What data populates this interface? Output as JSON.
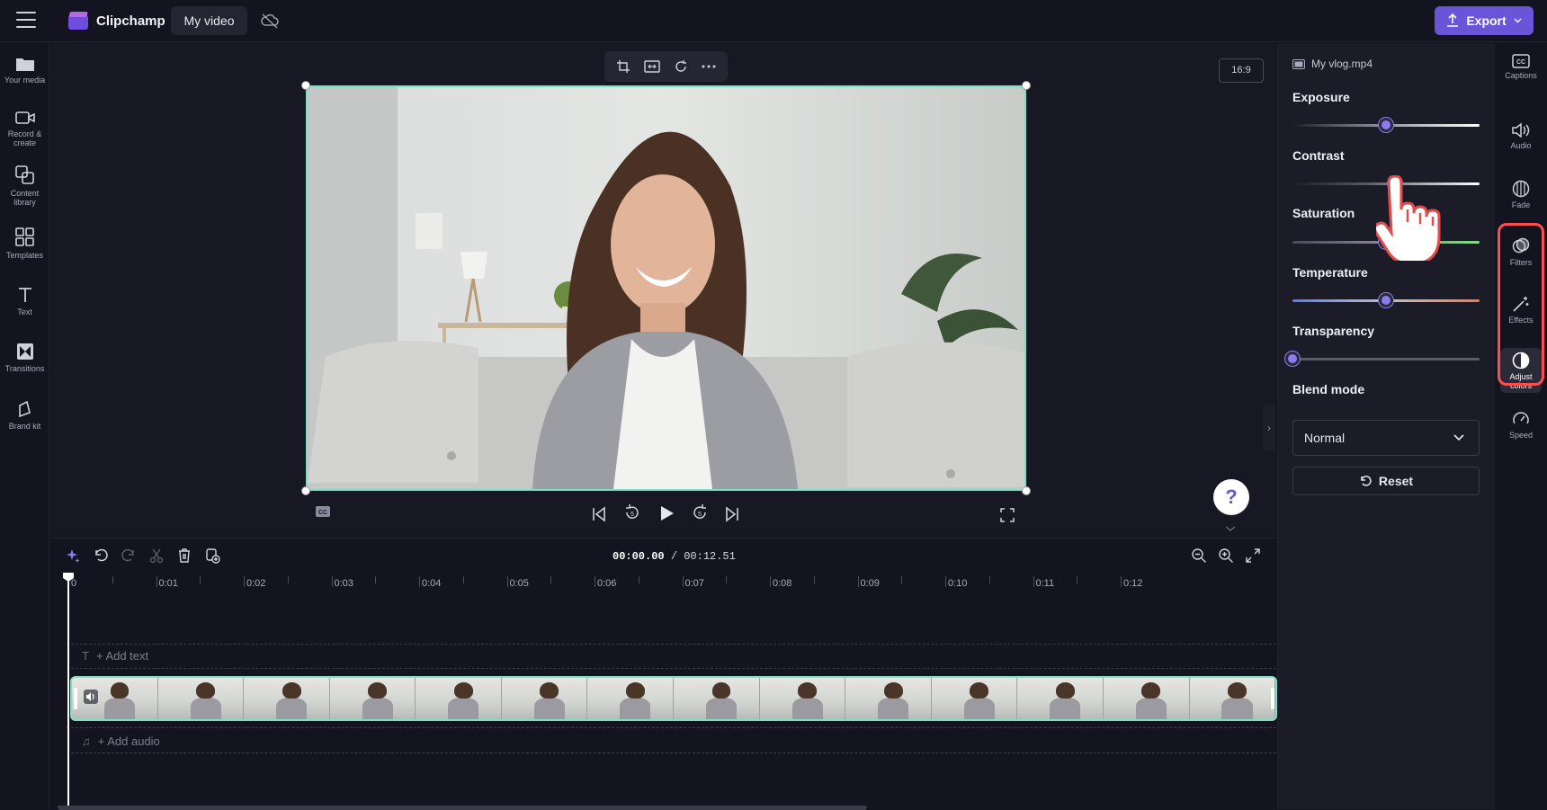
{
  "app": {
    "brand": "Clipchamp",
    "project_title": "My video",
    "export_label": "Export",
    "accent": "#6a55d8",
    "selection_color": "#7ee0c3"
  },
  "left_sidebar": {
    "items": [
      {
        "label": "Your media",
        "icon": "folder-icon"
      },
      {
        "label": "Record & create",
        "icon": "camera-icon"
      },
      {
        "label": "Content library",
        "icon": "library-icon"
      },
      {
        "label": "Templates",
        "icon": "templates-icon"
      },
      {
        "label": "Text",
        "icon": "text-icon"
      },
      {
        "label": "Transitions",
        "icon": "transitions-icon"
      },
      {
        "label": "Brand kit",
        "icon": "brand-kit-icon"
      }
    ]
  },
  "preview": {
    "aspect_ratio": "16:9",
    "help_glyph": "?"
  },
  "timeline": {
    "current_time": "00:00.00",
    "total_time": "/ 00:12.51",
    "ruler_labels": [
      "0",
      "0:01",
      "0:02",
      "0:03",
      "0:04",
      "0:05",
      "0:06",
      "0:07",
      "0:08",
      "0:09",
      "0:10",
      "0:11",
      "0:12"
    ],
    "add_text": "+ Add text",
    "add_audio": "+ Add audio"
  },
  "properties": {
    "file_name": "My vlog.mp4",
    "exposure_label": "Exposure",
    "exposure_value": 0.5,
    "contrast_label": "Contrast",
    "contrast_value": 0.55,
    "saturation_label": "Saturation",
    "saturation_value": 0.5,
    "temperature_label": "Temperature",
    "temperature_value": 0.5,
    "transparency_label": "Transparency",
    "transparency_value": 0.0,
    "blend_mode_label": "Blend mode",
    "blend_mode_value": "Normal",
    "reset_label": "Reset"
  },
  "right_rail": {
    "items": [
      {
        "label": "Captions",
        "icon": "captions-icon"
      },
      {
        "label": "Audio",
        "icon": "audio-icon"
      },
      {
        "label": "Fade",
        "icon": "fade-icon"
      },
      {
        "label": "Filters",
        "icon": "filters-icon"
      },
      {
        "label": "Effects",
        "icon": "effects-icon"
      },
      {
        "label": "Adjust colors",
        "icon": "adjust-colors-icon"
      },
      {
        "label": "Speed",
        "icon": "speed-icon"
      }
    ]
  }
}
